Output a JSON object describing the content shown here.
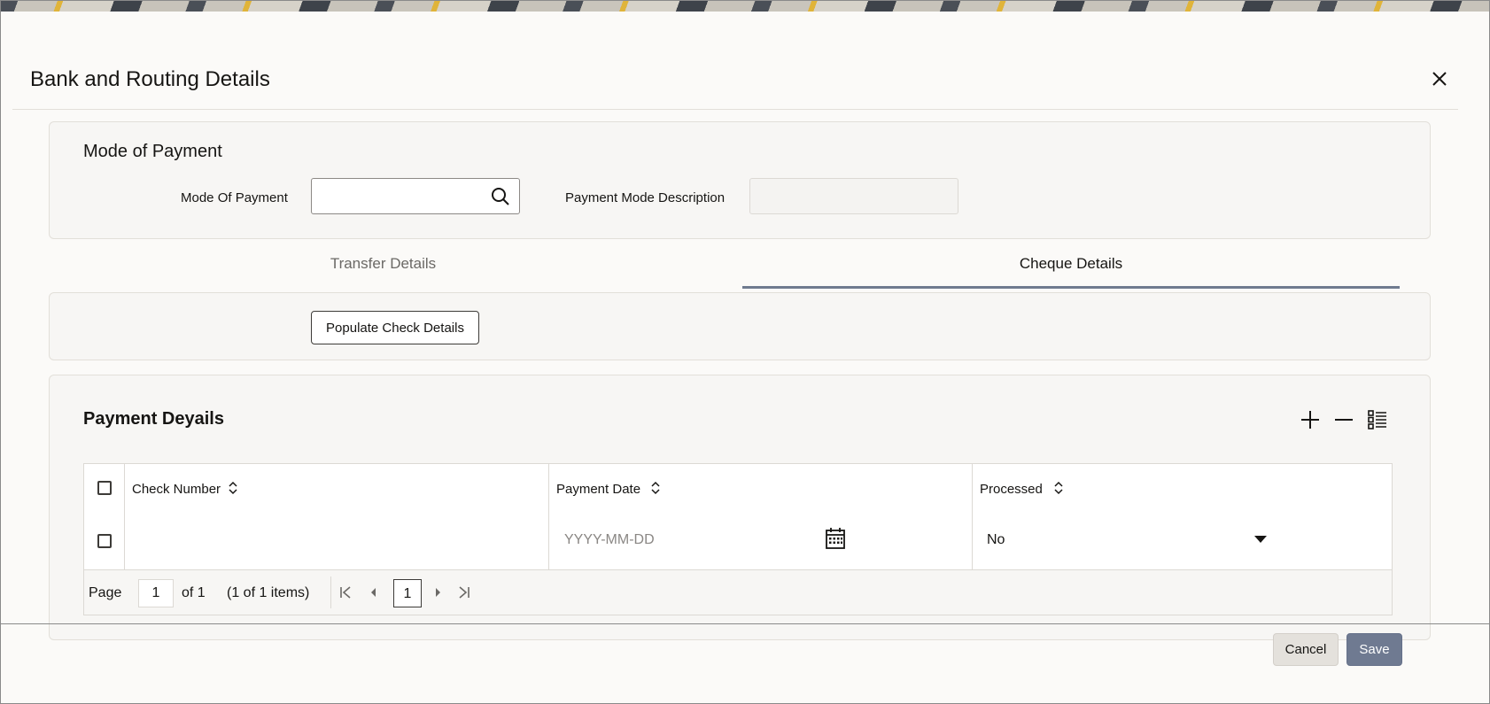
{
  "dialog": {
    "title": "Bank and Routing Details"
  },
  "mode_of_payment": {
    "section_title": "Mode of Payment",
    "mode_label": "Mode Of Payment",
    "mode_value": "",
    "description_label": "Payment Mode Description",
    "description_value": ""
  },
  "tabs": [
    {
      "label": "Transfer Details",
      "selected": false
    },
    {
      "label": "Cheque Details",
      "selected": true
    }
  ],
  "cheque_details": {
    "populate_button": "Populate Check Details"
  },
  "payment_details": {
    "section_title": "Payment Deyails",
    "toolbar": {
      "add_icon": "add-icon",
      "remove_icon": "remove-icon",
      "columns_icon": "columns-icon"
    },
    "columns": [
      "Check Number",
      "Payment Date",
      "Processed"
    ],
    "rows": [
      {
        "check_number": "",
        "payment_date_placeholder": "YYYY-MM-DD",
        "processed": "No"
      }
    ],
    "pagination": {
      "page_label": "Page",
      "page_value": "1",
      "of_text": "of 1",
      "items_text": "(1 of 1 items)",
      "current_page": "1"
    }
  },
  "footer": {
    "cancel_label": "Cancel",
    "save_label": "Save"
  },
  "colors": {
    "accent": "#6f7a91",
    "panel_bg": "#f7f6f4",
    "text": "#161513"
  }
}
